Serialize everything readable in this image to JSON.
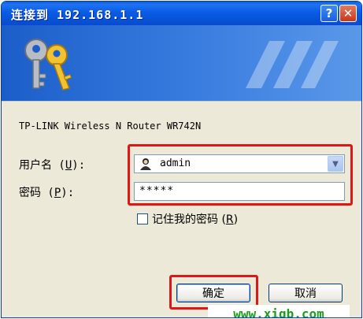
{
  "window": {
    "title": "连接到 192.168.1.1",
    "help_button": "?",
    "close_button": "✕"
  },
  "banner": {
    "icon": "keys-icon"
  },
  "dialog": {
    "router_name": "TP-LINK Wireless N Router WR742N",
    "username_label_pre": "用户名 (",
    "username_label_key": "U",
    "username_label_post": "):",
    "password_label_pre": "密码 (",
    "password_label_key": "P",
    "password_label_post": "):",
    "username_value": "admin",
    "password_value": "*****",
    "remember_label_pre": "记住我的密码 (",
    "remember_label_key": "R",
    "remember_label_post": ")",
    "ok_label": "确定",
    "cancel_label": "取消"
  },
  "watermark": "www.xiqb.com",
  "colors": {
    "titlebar": "#0a5ce6",
    "highlight": "#e01515",
    "watermark": "#18a018"
  }
}
